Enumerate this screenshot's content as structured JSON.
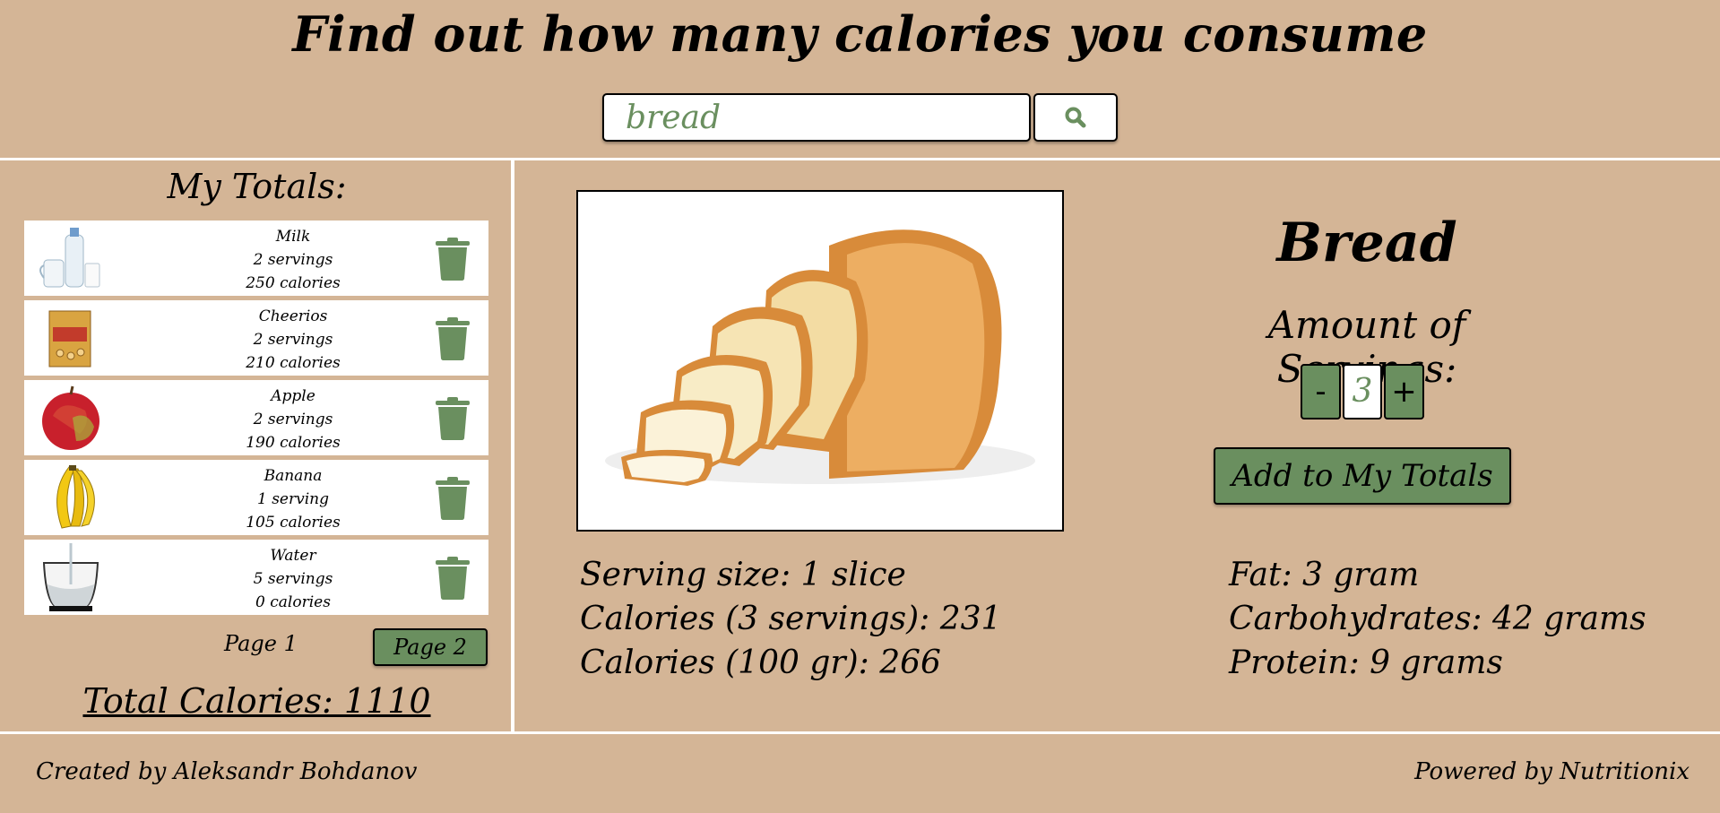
{
  "header": {
    "title": "Find out how many calories you consume",
    "search_value": "bread"
  },
  "totals": {
    "title": "My Totals:",
    "items": [
      {
        "name": "Milk",
        "servings": "2 servings",
        "calories": "250 calories",
        "icon": "milk-icon"
      },
      {
        "name": "Cheerios",
        "servings": "2 servings",
        "calories": "210 calories",
        "icon": "cheerios-icon"
      },
      {
        "name": "Apple",
        "servings": "2 servings",
        "calories": "190 calories",
        "icon": "apple-icon"
      },
      {
        "name": "Banana",
        "servings": "1 serving",
        "calories": "105 calories",
        "icon": "banana-icon"
      },
      {
        "name": "Water",
        "servings": "5 servings",
        "calories": "0 calories",
        "icon": "water-glass-icon"
      }
    ],
    "page_current": "Page 1",
    "page_next": "Page 2",
    "total_calories": "Total Calories: 1110"
  },
  "detail": {
    "food_name": "Bread",
    "servings_label": "Amount of Servings:",
    "decrement": "-",
    "servings_value": "3",
    "increment": "+",
    "add_button": "Add to My Totals",
    "left_info": [
      "Serving size: 1 slice",
      "Calories (3 servings): 231",
      "Calories (100 gr): 266"
    ],
    "right_info": [
      "Fat: 3 gram",
      "Carbohydrates: 42 grams",
      "Protein: 9 grams"
    ]
  },
  "footer": {
    "created_by": "Created by Aleksandr Bohdanov",
    "powered_by": "Powered by Nutritionix"
  },
  "colors": {
    "background": "#d4b596",
    "accent_green": "#6a8f5f",
    "divider": "#ffffff"
  }
}
